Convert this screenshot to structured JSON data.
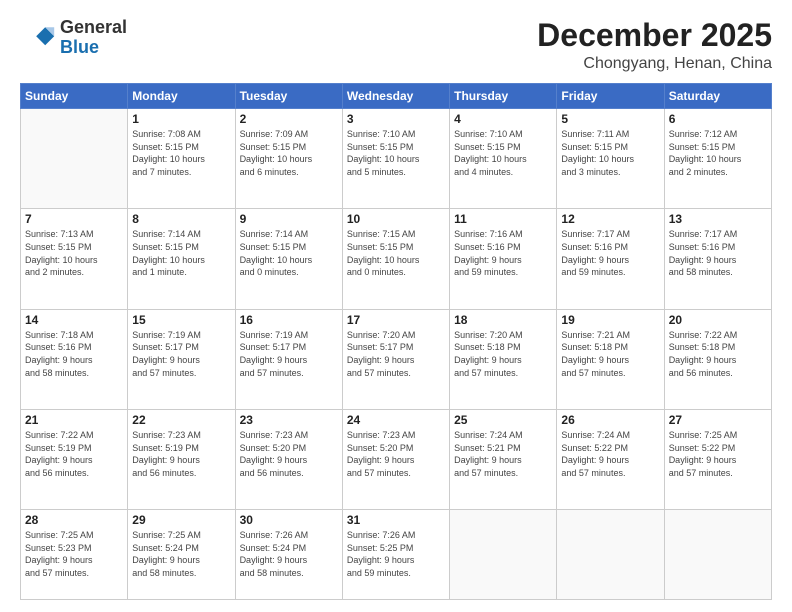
{
  "logo": {
    "general": "General",
    "blue": "Blue"
  },
  "header": {
    "month": "December 2025",
    "location": "Chongyang, Henan, China"
  },
  "weekdays": [
    "Sunday",
    "Monday",
    "Tuesday",
    "Wednesday",
    "Thursday",
    "Friday",
    "Saturday"
  ],
  "weeks": [
    [
      {
        "day": "",
        "info": ""
      },
      {
        "day": "1",
        "info": "Sunrise: 7:08 AM\nSunset: 5:15 PM\nDaylight: 10 hours\nand 7 minutes."
      },
      {
        "day": "2",
        "info": "Sunrise: 7:09 AM\nSunset: 5:15 PM\nDaylight: 10 hours\nand 6 minutes."
      },
      {
        "day": "3",
        "info": "Sunrise: 7:10 AM\nSunset: 5:15 PM\nDaylight: 10 hours\nand 5 minutes."
      },
      {
        "day": "4",
        "info": "Sunrise: 7:10 AM\nSunset: 5:15 PM\nDaylight: 10 hours\nand 4 minutes."
      },
      {
        "day": "5",
        "info": "Sunrise: 7:11 AM\nSunset: 5:15 PM\nDaylight: 10 hours\nand 3 minutes."
      },
      {
        "day": "6",
        "info": "Sunrise: 7:12 AM\nSunset: 5:15 PM\nDaylight: 10 hours\nand 2 minutes."
      }
    ],
    [
      {
        "day": "7",
        "info": "Sunrise: 7:13 AM\nSunset: 5:15 PM\nDaylight: 10 hours\nand 2 minutes."
      },
      {
        "day": "8",
        "info": "Sunrise: 7:14 AM\nSunset: 5:15 PM\nDaylight: 10 hours\nand 1 minute."
      },
      {
        "day": "9",
        "info": "Sunrise: 7:14 AM\nSunset: 5:15 PM\nDaylight: 10 hours\nand 0 minutes."
      },
      {
        "day": "10",
        "info": "Sunrise: 7:15 AM\nSunset: 5:15 PM\nDaylight: 10 hours\nand 0 minutes."
      },
      {
        "day": "11",
        "info": "Sunrise: 7:16 AM\nSunset: 5:16 PM\nDaylight: 9 hours\nand 59 minutes."
      },
      {
        "day": "12",
        "info": "Sunrise: 7:17 AM\nSunset: 5:16 PM\nDaylight: 9 hours\nand 59 minutes."
      },
      {
        "day": "13",
        "info": "Sunrise: 7:17 AM\nSunset: 5:16 PM\nDaylight: 9 hours\nand 58 minutes."
      }
    ],
    [
      {
        "day": "14",
        "info": "Sunrise: 7:18 AM\nSunset: 5:16 PM\nDaylight: 9 hours\nand 58 minutes."
      },
      {
        "day": "15",
        "info": "Sunrise: 7:19 AM\nSunset: 5:17 PM\nDaylight: 9 hours\nand 57 minutes."
      },
      {
        "day": "16",
        "info": "Sunrise: 7:19 AM\nSunset: 5:17 PM\nDaylight: 9 hours\nand 57 minutes."
      },
      {
        "day": "17",
        "info": "Sunrise: 7:20 AM\nSunset: 5:17 PM\nDaylight: 9 hours\nand 57 minutes."
      },
      {
        "day": "18",
        "info": "Sunrise: 7:20 AM\nSunset: 5:18 PM\nDaylight: 9 hours\nand 57 minutes."
      },
      {
        "day": "19",
        "info": "Sunrise: 7:21 AM\nSunset: 5:18 PM\nDaylight: 9 hours\nand 57 minutes."
      },
      {
        "day": "20",
        "info": "Sunrise: 7:22 AM\nSunset: 5:18 PM\nDaylight: 9 hours\nand 56 minutes."
      }
    ],
    [
      {
        "day": "21",
        "info": "Sunrise: 7:22 AM\nSunset: 5:19 PM\nDaylight: 9 hours\nand 56 minutes."
      },
      {
        "day": "22",
        "info": "Sunrise: 7:23 AM\nSunset: 5:19 PM\nDaylight: 9 hours\nand 56 minutes."
      },
      {
        "day": "23",
        "info": "Sunrise: 7:23 AM\nSunset: 5:20 PM\nDaylight: 9 hours\nand 56 minutes."
      },
      {
        "day": "24",
        "info": "Sunrise: 7:23 AM\nSunset: 5:20 PM\nDaylight: 9 hours\nand 57 minutes."
      },
      {
        "day": "25",
        "info": "Sunrise: 7:24 AM\nSunset: 5:21 PM\nDaylight: 9 hours\nand 57 minutes."
      },
      {
        "day": "26",
        "info": "Sunrise: 7:24 AM\nSunset: 5:22 PM\nDaylight: 9 hours\nand 57 minutes."
      },
      {
        "day": "27",
        "info": "Sunrise: 7:25 AM\nSunset: 5:22 PM\nDaylight: 9 hours\nand 57 minutes."
      }
    ],
    [
      {
        "day": "28",
        "info": "Sunrise: 7:25 AM\nSunset: 5:23 PM\nDaylight: 9 hours\nand 57 minutes."
      },
      {
        "day": "29",
        "info": "Sunrise: 7:25 AM\nSunset: 5:24 PM\nDaylight: 9 hours\nand 58 minutes."
      },
      {
        "day": "30",
        "info": "Sunrise: 7:26 AM\nSunset: 5:24 PM\nDaylight: 9 hours\nand 58 minutes."
      },
      {
        "day": "31",
        "info": "Sunrise: 7:26 AM\nSunset: 5:25 PM\nDaylight: 9 hours\nand 59 minutes."
      },
      {
        "day": "",
        "info": ""
      },
      {
        "day": "",
        "info": ""
      },
      {
        "day": "",
        "info": ""
      }
    ]
  ]
}
